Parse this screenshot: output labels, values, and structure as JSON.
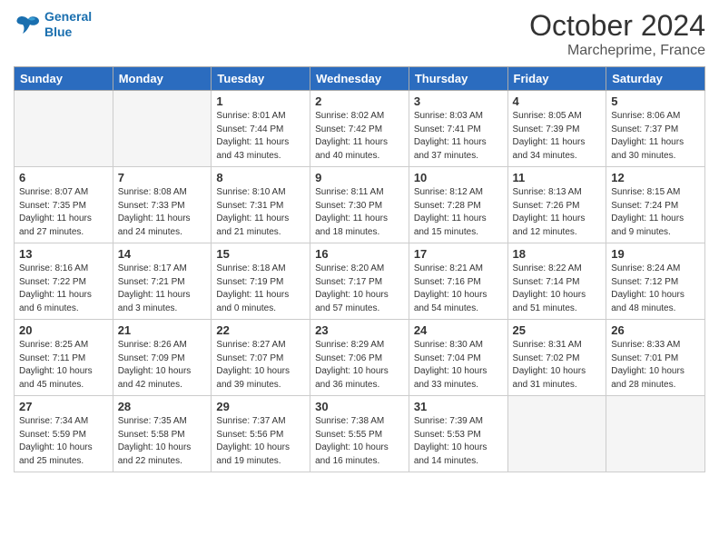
{
  "header": {
    "logo_line1": "General",
    "logo_line2": "Blue",
    "month": "October 2024",
    "location": "Marcheprime, France"
  },
  "weekdays": [
    "Sunday",
    "Monday",
    "Tuesday",
    "Wednesday",
    "Thursday",
    "Friday",
    "Saturday"
  ],
  "weeks": [
    [
      {
        "day": "",
        "info": ""
      },
      {
        "day": "",
        "info": ""
      },
      {
        "day": "1",
        "info": "Sunrise: 8:01 AM\nSunset: 7:44 PM\nDaylight: 11 hours\nand 43 minutes."
      },
      {
        "day": "2",
        "info": "Sunrise: 8:02 AM\nSunset: 7:42 PM\nDaylight: 11 hours\nand 40 minutes."
      },
      {
        "day": "3",
        "info": "Sunrise: 8:03 AM\nSunset: 7:41 PM\nDaylight: 11 hours\nand 37 minutes."
      },
      {
        "day": "4",
        "info": "Sunrise: 8:05 AM\nSunset: 7:39 PM\nDaylight: 11 hours\nand 34 minutes."
      },
      {
        "day": "5",
        "info": "Sunrise: 8:06 AM\nSunset: 7:37 PM\nDaylight: 11 hours\nand 30 minutes."
      }
    ],
    [
      {
        "day": "6",
        "info": "Sunrise: 8:07 AM\nSunset: 7:35 PM\nDaylight: 11 hours\nand 27 minutes."
      },
      {
        "day": "7",
        "info": "Sunrise: 8:08 AM\nSunset: 7:33 PM\nDaylight: 11 hours\nand 24 minutes."
      },
      {
        "day": "8",
        "info": "Sunrise: 8:10 AM\nSunset: 7:31 PM\nDaylight: 11 hours\nand 21 minutes."
      },
      {
        "day": "9",
        "info": "Sunrise: 8:11 AM\nSunset: 7:30 PM\nDaylight: 11 hours\nand 18 minutes."
      },
      {
        "day": "10",
        "info": "Sunrise: 8:12 AM\nSunset: 7:28 PM\nDaylight: 11 hours\nand 15 minutes."
      },
      {
        "day": "11",
        "info": "Sunrise: 8:13 AM\nSunset: 7:26 PM\nDaylight: 11 hours\nand 12 minutes."
      },
      {
        "day": "12",
        "info": "Sunrise: 8:15 AM\nSunset: 7:24 PM\nDaylight: 11 hours\nand 9 minutes."
      }
    ],
    [
      {
        "day": "13",
        "info": "Sunrise: 8:16 AM\nSunset: 7:22 PM\nDaylight: 11 hours\nand 6 minutes."
      },
      {
        "day": "14",
        "info": "Sunrise: 8:17 AM\nSunset: 7:21 PM\nDaylight: 11 hours\nand 3 minutes."
      },
      {
        "day": "15",
        "info": "Sunrise: 8:18 AM\nSunset: 7:19 PM\nDaylight: 11 hours\nand 0 minutes."
      },
      {
        "day": "16",
        "info": "Sunrise: 8:20 AM\nSunset: 7:17 PM\nDaylight: 10 hours\nand 57 minutes."
      },
      {
        "day": "17",
        "info": "Sunrise: 8:21 AM\nSunset: 7:16 PM\nDaylight: 10 hours\nand 54 minutes."
      },
      {
        "day": "18",
        "info": "Sunrise: 8:22 AM\nSunset: 7:14 PM\nDaylight: 10 hours\nand 51 minutes."
      },
      {
        "day": "19",
        "info": "Sunrise: 8:24 AM\nSunset: 7:12 PM\nDaylight: 10 hours\nand 48 minutes."
      }
    ],
    [
      {
        "day": "20",
        "info": "Sunrise: 8:25 AM\nSunset: 7:11 PM\nDaylight: 10 hours\nand 45 minutes."
      },
      {
        "day": "21",
        "info": "Sunrise: 8:26 AM\nSunset: 7:09 PM\nDaylight: 10 hours\nand 42 minutes."
      },
      {
        "day": "22",
        "info": "Sunrise: 8:27 AM\nSunset: 7:07 PM\nDaylight: 10 hours\nand 39 minutes."
      },
      {
        "day": "23",
        "info": "Sunrise: 8:29 AM\nSunset: 7:06 PM\nDaylight: 10 hours\nand 36 minutes."
      },
      {
        "day": "24",
        "info": "Sunrise: 8:30 AM\nSunset: 7:04 PM\nDaylight: 10 hours\nand 33 minutes."
      },
      {
        "day": "25",
        "info": "Sunrise: 8:31 AM\nSunset: 7:02 PM\nDaylight: 10 hours\nand 31 minutes."
      },
      {
        "day": "26",
        "info": "Sunrise: 8:33 AM\nSunset: 7:01 PM\nDaylight: 10 hours\nand 28 minutes."
      }
    ],
    [
      {
        "day": "27",
        "info": "Sunrise: 7:34 AM\nSunset: 5:59 PM\nDaylight: 10 hours\nand 25 minutes."
      },
      {
        "day": "28",
        "info": "Sunrise: 7:35 AM\nSunset: 5:58 PM\nDaylight: 10 hours\nand 22 minutes."
      },
      {
        "day": "29",
        "info": "Sunrise: 7:37 AM\nSunset: 5:56 PM\nDaylight: 10 hours\nand 19 minutes."
      },
      {
        "day": "30",
        "info": "Sunrise: 7:38 AM\nSunset: 5:55 PM\nDaylight: 10 hours\nand 16 minutes."
      },
      {
        "day": "31",
        "info": "Sunrise: 7:39 AM\nSunset: 5:53 PM\nDaylight: 10 hours\nand 14 minutes."
      },
      {
        "day": "",
        "info": ""
      },
      {
        "day": "",
        "info": ""
      }
    ]
  ]
}
